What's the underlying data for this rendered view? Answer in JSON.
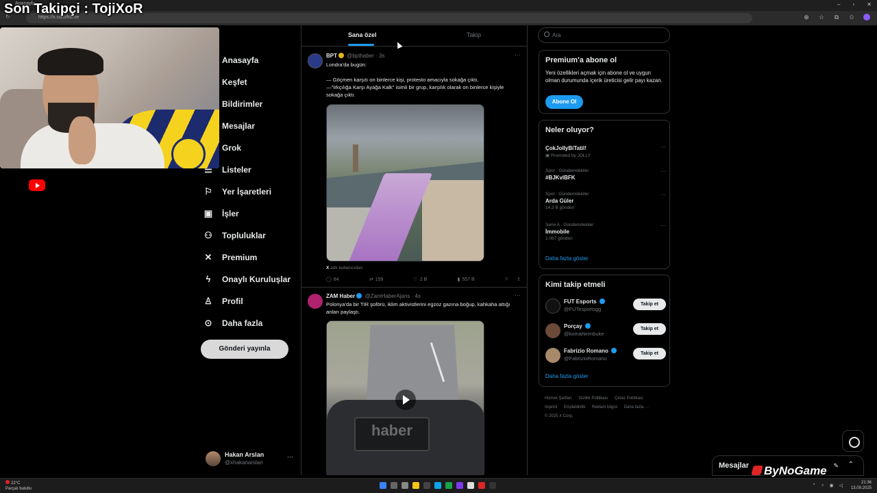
{
  "overlay": {
    "title": "Son Takipçi : TojiXoR",
    "sponsor": "ByNoGame"
  },
  "browser": {
    "tab_title": "Anasayfa",
    "url": "https://x.com/home"
  },
  "nav": {
    "items": [
      {
        "label": "Anasayfa",
        "icon": "home-icon"
      },
      {
        "label": "Keşfet",
        "icon": "search-icon"
      },
      {
        "label": "Bildirimler",
        "icon": "bell-icon"
      },
      {
        "label": "Mesajlar",
        "icon": "mail-icon"
      },
      {
        "label": "Grok",
        "icon": "grok-icon"
      },
      {
        "label": "Listeler",
        "icon": "list-icon"
      },
      {
        "label": "Yer İşaretleri",
        "icon": "bookmark-icon"
      },
      {
        "label": "İşler",
        "icon": "briefcase-icon"
      },
      {
        "label": "Topluluklar",
        "icon": "people-icon"
      },
      {
        "label": "Premium",
        "icon": "x-logo-icon"
      },
      {
        "label": "Onaylı Kuruluşlar",
        "icon": "lightning-icon"
      },
      {
        "label": "Profil",
        "icon": "user-icon"
      },
      {
        "label": "Daha fazla",
        "icon": "more-circle-icon"
      }
    ],
    "post_button": "Gönderi yayınla",
    "account": {
      "name": "Hakan Arslan",
      "handle": "@xhakanarslan"
    }
  },
  "feed": {
    "tabs": {
      "active": "Sana özel",
      "inactive": "Takip"
    },
    "tweets": [
      {
        "name": "BPT",
        "handle": "@bpthaber",
        "time": "· 3s",
        "text1": "Londra'da bugün:",
        "text2": "— Göçmen karşıtı on binlerce kişi, protesto amacıyla sokağa çıktı.",
        "text3": "—\"Irkçılığa Karşı Ayağa Kalk\" isimli bir grup, karşılık olarak on binlerce kişiyle sokağa çıktı.",
        "attribution": "adlı kullanıcıdan",
        "replies": "84",
        "reposts": "159",
        "likes": "2 B",
        "views": "557 B"
      },
      {
        "name": "ZAM Haber",
        "handle": "@ZamHaberAjans",
        "time": "· 4s",
        "text1": "Polonya'da bir TIR şoförü, iklim aktivistlerini egzoz gazına boğup, kahkaha attığı anları paylaştı.",
        "watermark": "haber"
      }
    ]
  },
  "sidebar": {
    "search_placeholder": "Ara",
    "premium": {
      "title": "Premium'a abone ol",
      "text": "Yeni özellikleri açmak için abone ol ve uygun olman durumunda içerik üreticisi gelir payı kazan.",
      "button": "Abone Ol"
    },
    "trends": {
      "title": "Neler oluyor?",
      "items": [
        {
          "meta": "",
          "title": "ÇokJollyBiTatil!",
          "count": "Promoted by JOLLY"
        },
        {
          "meta": "Spor · Gündemdekiler",
          "title": "#BJKvlBFK",
          "count": ""
        },
        {
          "meta": "Spor · Gündemdekiler",
          "title": "Arda Güler",
          "count": "14,3 B gönderi"
        },
        {
          "meta": "Serie A · Gündemdekiler",
          "title": "İmmobile",
          "count": "1.067 gönderi"
        }
      ],
      "show_more": "Daha fazla göster"
    },
    "who_to_follow": {
      "title": "Kimi takip etmeli",
      "items": [
        {
          "name": "FUT Esports",
          "handle": "@FUTesportsgg",
          "button": "Takip et"
        },
        {
          "name": "Porçay",
          "handle": "@komahirimbuke",
          "button": "Takip et"
        },
        {
          "name": "Fabrizio Romano",
          "handle": "@FabrizioRomano",
          "button": "Takip et"
        }
      ],
      "show_more": "Daha fazla göster"
    },
    "footer": {
      "links": [
        "Hizmet Şartları",
        "Gizlilik Politikası",
        "Çerez Politikası",
        "Imprint",
        "Erişilebilirlik",
        "Reklam bilgisi",
        "Daha fazla ···"
      ],
      "copyright": "© 2025 X Corp."
    }
  },
  "messages_drawer": {
    "label": "Mesajlar"
  },
  "taskbar": {
    "weather_temp": "22°C",
    "weather_text": "Parçalı bulutlu",
    "time": "21:36",
    "date": "13.09.2025"
  },
  "colors": {
    "accent": "#1d9bf0",
    "background": "#000000",
    "border": "#2f3336",
    "muted": "#71767b"
  }
}
